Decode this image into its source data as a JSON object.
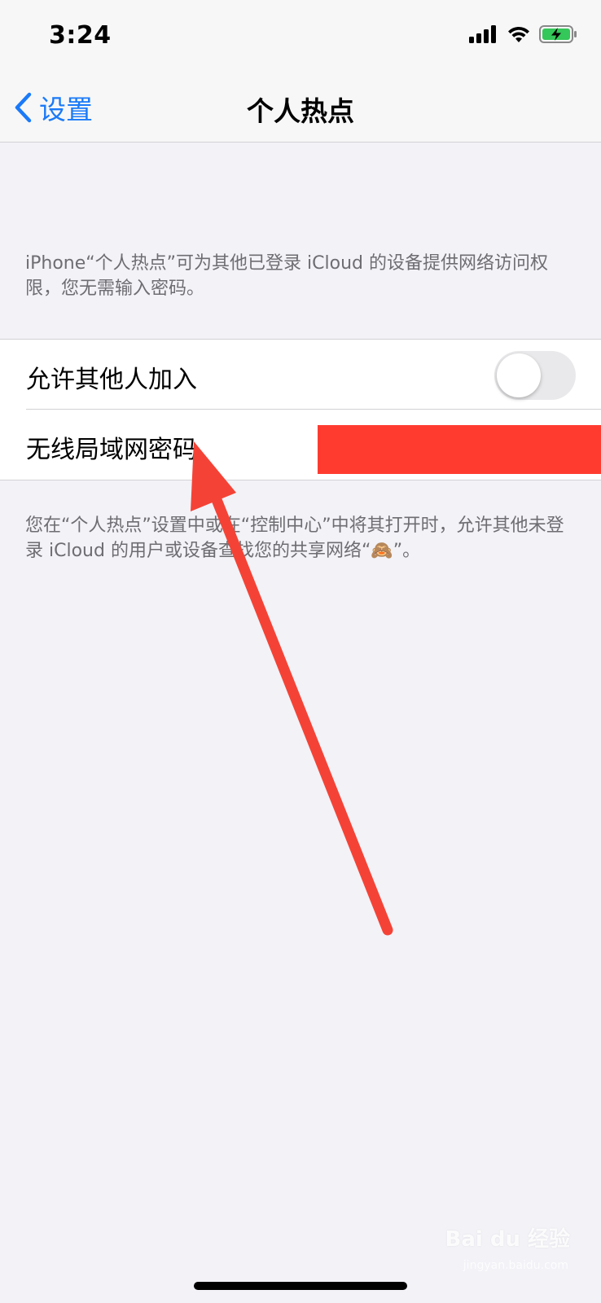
{
  "status_bar": {
    "time": "3:24",
    "icons": [
      "cellular-signal-icon",
      "wifi-icon",
      "battery-charging-icon"
    ]
  },
  "nav": {
    "back_label": "设置",
    "title": "个人热点",
    "accent_color": "#1a7af8"
  },
  "header_note": "iPhone“个人热点”可为其他已登录 iCloud 的设备提供网络访问权限，您无需输入密码。",
  "settings": {
    "allow_others": {
      "label": "允许其他人加入",
      "enabled": false
    },
    "wifi_password": {
      "label": "无线局域网密码",
      "value_redacted": true,
      "redaction_color": "#ff3b30"
    }
  },
  "footer_note": "您在“个人热点”设置中或在“控制中心”中将其打开时，允许其他未登录 iCloud 的用户或设备查找您的共享网络“🙈”。",
  "annotation": {
    "arrow_color": "#f44336"
  },
  "watermark": {
    "brand": "Bai du 经验",
    "url": "jingyan.baidu.com"
  }
}
